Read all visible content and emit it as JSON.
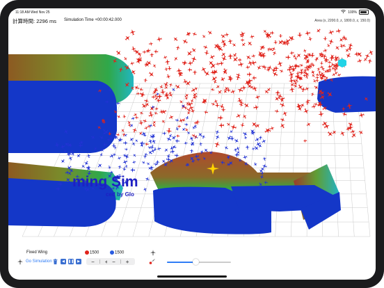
{
  "status_bar": {
    "time": "11:18 AM  Wed Nov 25",
    "battery": "100%"
  },
  "info": {
    "calc_time_label": "計算時間:",
    "calc_time_value": "2296 ms",
    "sim_time": "Simulation Time +00:00:42.000",
    "area": "Area (x, 2200.0,  z, 1800.0,  z, 150.0)"
  },
  "scene": {
    "overlay_title": "ming Sim",
    "overlay_sub": "ced  by Glo",
    "red_color": "#e0231b",
    "blue_color": "#2233d4",
    "terrain_blue": "#1437c8",
    "marker_color": "#ffd400",
    "cyan_hex": "#22d3e6"
  },
  "toolbar": {
    "aircraft_type": "Fixed Wing",
    "red_count": "1500",
    "blue_count": "1500",
    "go_simulation": "Go Simulation",
    "slider_value": 0.45
  }
}
